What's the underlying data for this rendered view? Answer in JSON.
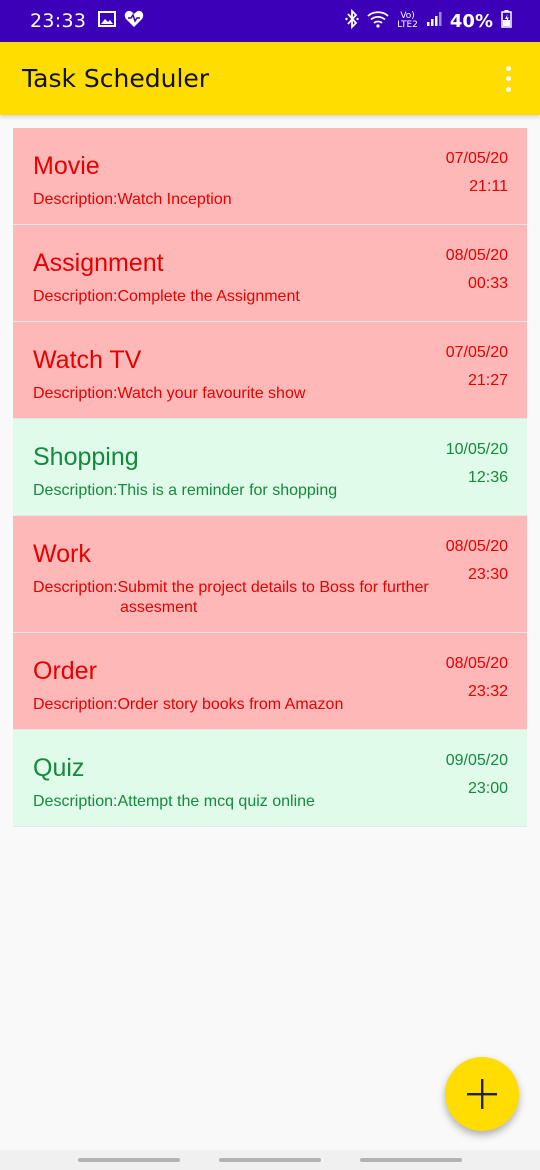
{
  "status_bar": {
    "time": "23:33",
    "network_top": "Vo)",
    "network_bottom": "LTE2",
    "battery": "40%",
    "icons": [
      "gallery-icon",
      "heart-icon",
      "bluetooth-icon",
      "wifi-icon",
      "signal-icon",
      "battery-icon"
    ]
  },
  "app_bar": {
    "title": "Task Scheduler",
    "menu_icon": "more-vert-icon"
  },
  "colors": {
    "status_bar": "#3b00b8",
    "app_bar": "#ffdd00",
    "overdue_bg": "#ffb8b8",
    "overdue_text": "#e80000",
    "upcoming_bg": "#e0fbe9",
    "upcoming_text": "#138a3c",
    "fab": "#ffdd00"
  },
  "tasks": [
    {
      "title": "Movie",
      "description": "Description:Watch Inception",
      "date": "07/05/20",
      "time": "21:11",
      "status": "overdue"
    },
    {
      "title": "Assignment",
      "description": "Description:Complete the Assignment",
      "date": "08/05/20",
      "time": "00:33",
      "status": "overdue"
    },
    {
      "title": "Watch TV",
      "description": "Description:Watch your favourite show",
      "date": "07/05/20",
      "time": "21:27",
      "status": "overdue"
    },
    {
      "title": "Shopping",
      "description": "Description:This is a reminder for shopping",
      "date": "10/05/20",
      "time": "12:36",
      "status": "upcoming"
    },
    {
      "title": "Work",
      "description": "Description:Submit the project details to Boss for further",
      "description_cont": "assesment",
      "date": "08/05/20",
      "time": "23:30",
      "status": "overdue"
    },
    {
      "title": "Order",
      "description": "Description:Order story books from Amazon",
      "date": "08/05/20",
      "time": "23:32",
      "status": "overdue"
    },
    {
      "title": "Quiz",
      "description": "Description:Attempt the mcq quiz online",
      "date": "09/05/20",
      "time": "23:00",
      "status": "upcoming"
    }
  ],
  "fab": {
    "icon": "plus-icon"
  }
}
